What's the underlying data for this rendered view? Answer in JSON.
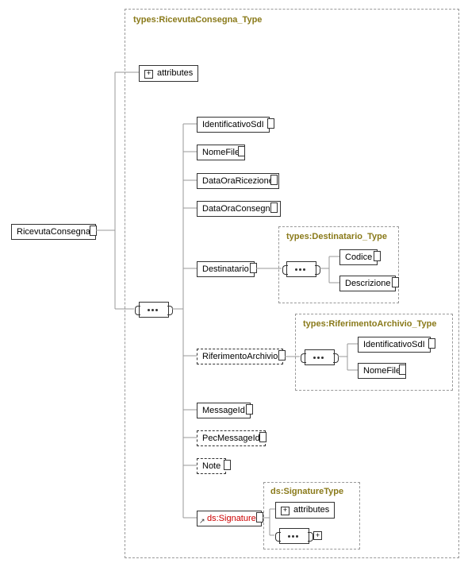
{
  "root": "RicevutaConsegna",
  "rootType": "types:RicevutaConsegna_Type",
  "attributes": "attributes",
  "children": {
    "identificativoSdI": "IdentificativoSdI",
    "nomeFile": "NomeFile",
    "dataOraRicezione": "DataOraRicezione",
    "dataOraConsegna": "DataOraConsegna",
    "destinatario": "Destinatario",
    "riferimentoArchivio": "RiferimentoArchivio",
    "messageId": "MessageId",
    "pecMessageId": "PecMessageId",
    "note": "Note",
    "signature": "ds:Signature"
  },
  "destinatario": {
    "typeLabel": "types:Destinatario_Type",
    "codice": "Codice",
    "descrizione": "Descrizione"
  },
  "riferimentoArchivio": {
    "typeLabel": "types:RiferimentoArchivio_Type",
    "identificativoSdI": "IdentificativoSdI",
    "nomeFile": "NomeFile"
  },
  "signature": {
    "typeLabel": "ds:SignatureType",
    "attributes": "attributes"
  }
}
